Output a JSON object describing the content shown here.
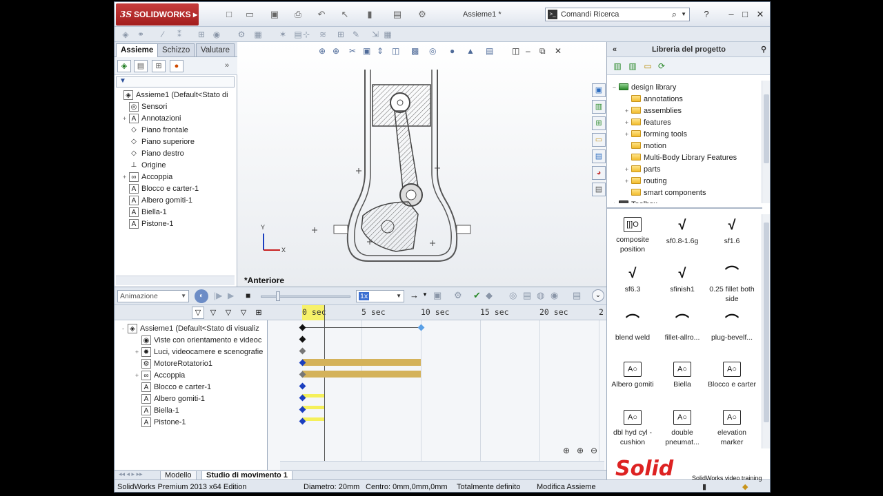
{
  "app": {
    "brand": "SOLIDWORKS",
    "doc_title": "Assieme1 *",
    "search_placeholder": "Comandi Ricerca"
  },
  "manager": {
    "tabs": [
      "Assieme",
      "Schizzo",
      "Valutare"
    ],
    "filter_label": "▼",
    "tree": [
      {
        "label": "Assieme1  (Default<Stato di",
        "icon": "assembly-icon",
        "expand": ""
      },
      {
        "label": "Sensori",
        "icon": "sensor-icon",
        "expand": ""
      },
      {
        "label": "Annotazioni",
        "icon": "annotation-icon",
        "expand": "+"
      },
      {
        "label": "Piano frontale",
        "icon": "plane-icon",
        "expand": ""
      },
      {
        "label": "Piano superiore",
        "icon": "plane-icon",
        "expand": ""
      },
      {
        "label": "Piano destro",
        "icon": "plane-icon",
        "expand": ""
      },
      {
        "label": "Origine",
        "icon": "origin-icon",
        "expand": ""
      },
      {
        "label": "Accoppia",
        "icon": "mate-icon",
        "expand": "+"
      },
      {
        "label": "Blocco e carter-1",
        "icon": "part-icon",
        "expand": ""
      },
      {
        "label": "Albero gomiti-1",
        "icon": "part-icon",
        "expand": ""
      },
      {
        "label": "Biella-1",
        "icon": "part-icon",
        "expand": ""
      },
      {
        "label": "Pistone-1",
        "icon": "part-icon",
        "expand": ""
      }
    ]
  },
  "graphics": {
    "view_name": "*Anteriore",
    "axis_x": "X",
    "axis_y": "Y"
  },
  "motion": {
    "study_type": "Animazione",
    "playback_speed": "1x",
    "ruler": [
      "0 sec",
      "5 sec",
      "10 sec",
      "15 sec",
      "20 sec",
      "2"
    ],
    "tree": [
      {
        "label": "Assieme1  (Default<Stato di visualiz",
        "expand": "-"
      },
      {
        "label": "Viste con orientamento e videoc",
        "expand": ""
      },
      {
        "label": "Luci, videocamere e scenografie",
        "expand": "+"
      },
      {
        "label": "MotoreRotatorio1",
        "expand": ""
      },
      {
        "label": "Accoppia",
        "expand": "+"
      },
      {
        "label": "Blocco e carter-1",
        "expand": ""
      },
      {
        "label": "Albero gomiti-1",
        "expand": ""
      },
      {
        "label": "Biella-1",
        "expand": ""
      },
      {
        "label": "Pistone-1",
        "expand": ""
      }
    ]
  },
  "bottom_tabs": [
    "Modello",
    "Studio di movimento 1"
  ],
  "status": {
    "edition": "SolidWorks Premium 2013 x64 Edition",
    "diameter": "Diametro: 20mm",
    "center": "Centro: 0mm,0mm,0mm",
    "defined": "Totalmente definito",
    "mode": "Modifica Assieme"
  },
  "library": {
    "title": "Libreria del progetto",
    "tree_root": "design library",
    "folders": [
      {
        "label": "annotations",
        "expand": ""
      },
      {
        "label": "assemblies",
        "expand": "+"
      },
      {
        "label": "features",
        "expand": "+"
      },
      {
        "label": "forming tools",
        "expand": "+"
      },
      {
        "label": "motion",
        "expand": ""
      },
      {
        "label": "Multi-Body Library Features",
        "expand": ""
      },
      {
        "label": "parts",
        "expand": "+"
      },
      {
        "label": "routing",
        "expand": "+"
      },
      {
        "label": "smart components",
        "expand": ""
      }
    ],
    "toolbox": "Toolbox",
    "palette": [
      {
        "label": "composite position",
        "icon": "[|]O"
      },
      {
        "label": "sf0.8-1.6g",
        "icon": "√"
      },
      {
        "label": "sf1.6",
        "icon": "√"
      },
      {
        "label": "sf6.3",
        "icon": "√"
      },
      {
        "label": "sfinish1",
        "icon": "√"
      },
      {
        "label": "0.25 fillet both side",
        "icon": "⌒"
      },
      {
        "label": "blend weld",
        "icon": "⌒"
      },
      {
        "label": "fillet-allro...",
        "icon": "⌒"
      },
      {
        "label": "plug-bevelf...",
        "icon": "⌒"
      },
      {
        "label": "Albero gomiti",
        "icon": "A○"
      },
      {
        "label": "Biella",
        "icon": "A○"
      },
      {
        "label": "Blocco e carter",
        "icon": "A○"
      },
      {
        "label": "dbl hyd cyl - cushion",
        "icon": "A○"
      },
      {
        "label": "double pneumat...",
        "icon": "A○"
      },
      {
        "label": "elevation marker",
        "icon": "A○"
      }
    ]
  },
  "watermark": {
    "brand": "Solid",
    "tagline": "SolidWorks video training"
  },
  "colors": {
    "accent_red": "#c63d3d",
    "keyframe_blue": "#1b3fbf",
    "bar_gold": "#d4b25a",
    "bar_yellow": "#f5f05a"
  }
}
